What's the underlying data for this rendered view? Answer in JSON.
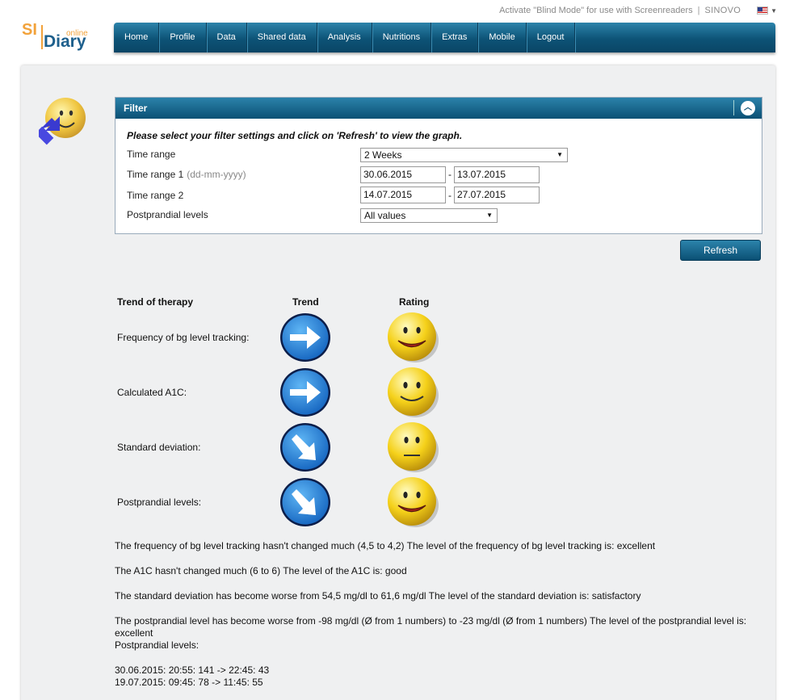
{
  "topbar": {
    "blind_mode": "Activate \"Blind Mode\" for use with Screenreaders",
    "separator": "|",
    "brand": "SINOVO"
  },
  "logo": {
    "si": "SI",
    "online": "online",
    "diary": "Diary"
  },
  "nav": {
    "items": [
      "Home",
      "Profile",
      "Data",
      "Shared data",
      "Analysis",
      "Nutritions",
      "Extras",
      "Mobile",
      "Logout"
    ]
  },
  "filter": {
    "title": "Filter",
    "intro": "Please select your filter settings and click on 'Refresh' to view the graph.",
    "time_range_label": "Time range",
    "time_range_value": "2 Weeks",
    "time_range1_label": "Time range 1",
    "date_hint": "(dd-mm-yyyy)",
    "time_range1_from": "30.06.2015",
    "time_range1_to": "13.07.2015",
    "time_range2_label": "Time range 2",
    "time_range2_from": "14.07.2015",
    "time_range2_to": "27.07.2015",
    "dash": "-",
    "postprandial_label": "Postprandial levels",
    "postprandial_value": "All values"
  },
  "refresh_label": "Refresh",
  "table": {
    "header_trend_of_therapy": "Trend of therapy",
    "header_trend": "Trend",
    "header_rating": "Rating",
    "rows": [
      {
        "label": "Frequency of bg level tracking:",
        "trend": "right-arrow-icon",
        "rating": "happy"
      },
      {
        "label": "Calculated A1C:",
        "trend": "right-arrow-icon",
        "rating": "smile"
      },
      {
        "label": "Standard deviation:",
        "trend": "down-right-arrow-icon",
        "rating": "neutral"
      },
      {
        "label": "Postprandial levels:",
        "trend": "down-right-arrow-icon",
        "rating": "happy"
      }
    ]
  },
  "summary": {
    "p1": "The frequency of bg level tracking hasn't changed much (4,5 to 4,2) The level of the frequency of bg level tracking is: excellent",
    "p2": "The A1C hasn't changed much (6 to 6) The level of the A1C is: good",
    "p3": "The standard deviation has become worse from 54,5 mg/dl to 61,6 mg/dl The level of the standard deviation is: satisfactory",
    "p4": "The postprandial level has become worse from -98 mg/dl (Ø from 1 numbers) to -23 mg/dl (Ø from 1 numbers) The level of the postprandial level is: excellent",
    "p5": "Postprandial levels:",
    "entry1": "30.06.2015: 20:55: 141 -> 22:45: 43",
    "entry2": "19.07.2015: 09:45: 78 -> 11:45: 55"
  }
}
